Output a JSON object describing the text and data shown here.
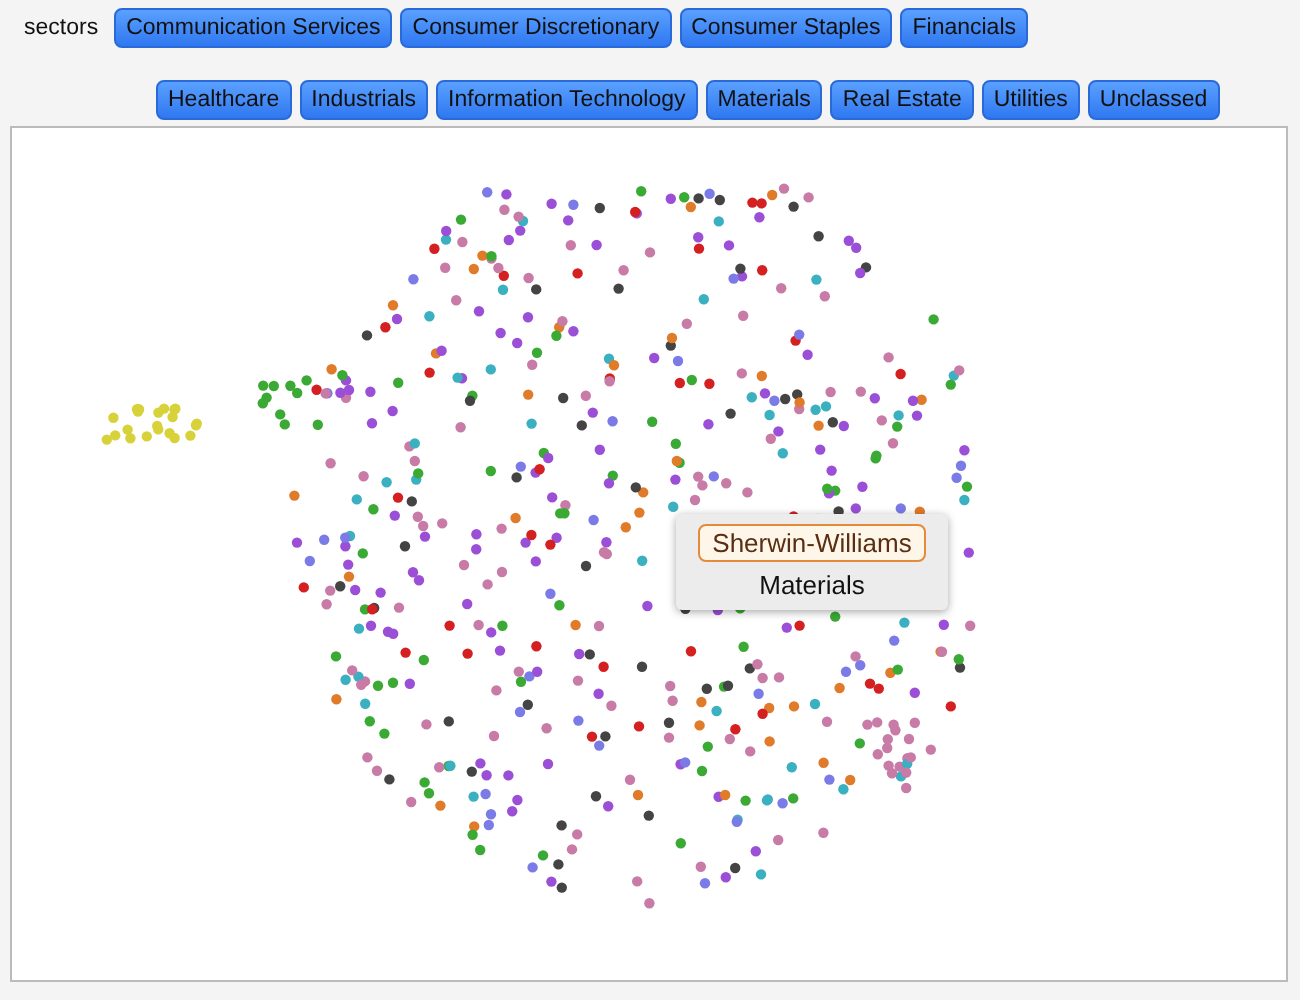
{
  "filter": {
    "label": "sectors",
    "buttons": [
      {
        "label": "Communication Services"
      },
      {
        "label": "Consumer Discretionary"
      },
      {
        "label": "Consumer Staples"
      },
      {
        "label": "Financials"
      },
      {
        "label": "Healthcare"
      },
      {
        "label": "Industrials"
      },
      {
        "label": "Information Technology"
      },
      {
        "label": "Materials"
      },
      {
        "label": "Real Estate"
      },
      {
        "label": "Utilities"
      },
      {
        "label": "Unclassed"
      }
    ]
  },
  "plot": {
    "tooltip": {
      "name": "Sherwin-Williams",
      "sector": "Materials"
    }
  }
}
